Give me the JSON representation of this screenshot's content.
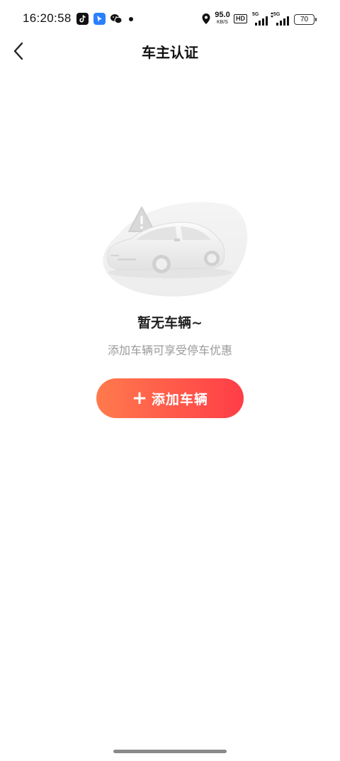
{
  "status_bar": {
    "time": "16:20:58",
    "net_speed_value": "95.0",
    "net_speed_unit": "KB/S",
    "hd_label": "HD",
    "signal1_label": "5G",
    "signal2_label": "5G",
    "battery_level": "70",
    "app_icons": [
      "tiktok-icon",
      "blue-app-icon",
      "wechat-icon"
    ]
  },
  "nav": {
    "title": "车主认证"
  },
  "empty_state": {
    "title": "暂无车辆~",
    "subtitle": "添加车辆可享受停车优惠",
    "add_button_icon": "+",
    "add_button_label": "添加车辆"
  },
  "colors": {
    "button_gradient_start": "#ff7a4d",
    "button_gradient_end": "#ff3d47"
  }
}
